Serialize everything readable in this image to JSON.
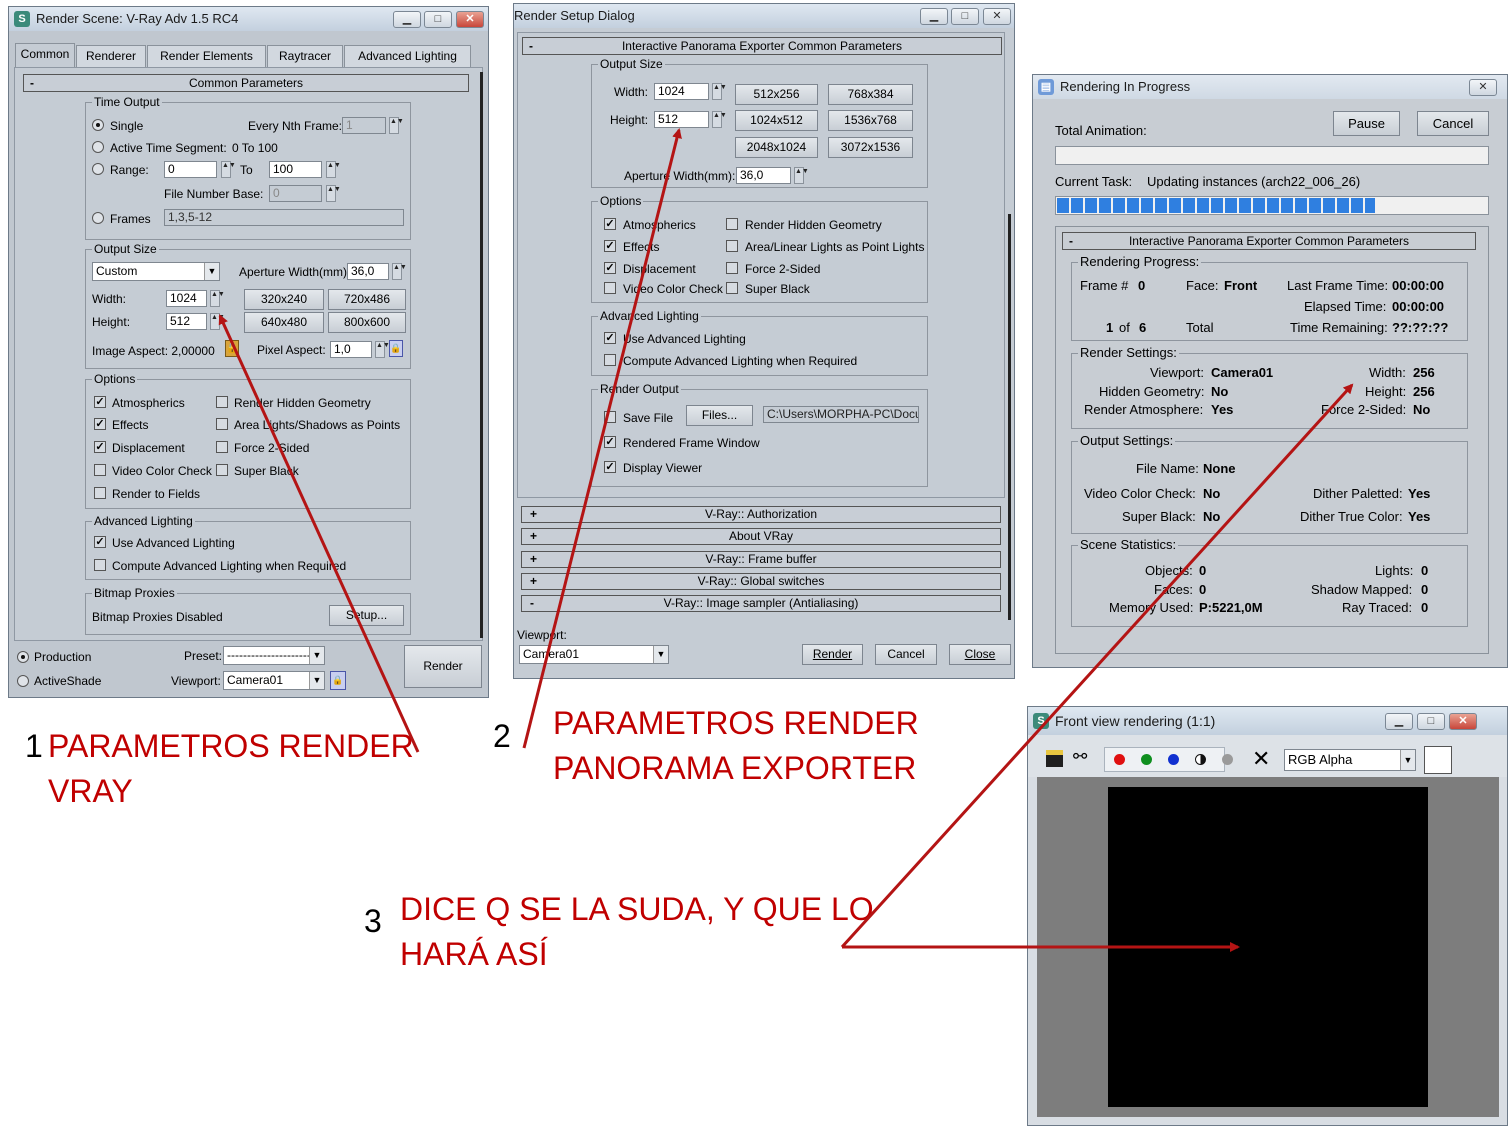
{
  "win1": {
    "title": "Render Scene: V-Ray Adv 1.5 RC4",
    "tabs": [
      "Common",
      "Renderer",
      "Render Elements",
      "Raytracer",
      "Advanced Lighting"
    ],
    "section": "Common Parameters",
    "time_output": {
      "label": "Time Output",
      "single": "Single",
      "every_nth": "Every Nth Frame:",
      "every_nth_value": "1",
      "active_segment": "Active Time Segment:",
      "active_segment_value": "0 To 100",
      "range": "Range:",
      "range_from": "0",
      "to": "To",
      "range_to": "100",
      "file_number_base": "File Number Base:",
      "file_number_base_value": "0",
      "frames": "Frames",
      "frames_value": "1,3,5-12"
    },
    "output_size": {
      "label": "Output Size",
      "preset": "Custom",
      "aperture": "Aperture Width(mm):",
      "aperture_value": "36,0",
      "width_label": "Width:",
      "width_value": "1024",
      "height_label": "Height:",
      "height_value": "512",
      "presets": [
        "320x240",
        "720x486",
        "640x480",
        "800x600"
      ],
      "image_aspect": "Image Aspect: 2,00000",
      "pixel_aspect": "Pixel Aspect:",
      "pixel_aspect_value": "1,0"
    },
    "options": {
      "label": "Options",
      "left": [
        "Atmospherics",
        "Effects",
        "Displacement",
        "Video Color Check",
        "Render to Fields"
      ],
      "right": [
        "Render Hidden Geometry",
        "Area Lights/Shadows as Points",
        "Force 2-Sided",
        "Super Black"
      ]
    },
    "advanced_lighting": {
      "label": "Advanced Lighting",
      "use": "Use Advanced Lighting",
      "compute": "Compute Advanced Lighting when Required"
    },
    "bitmap_proxies": {
      "label": "Bitmap Proxies",
      "status": "Bitmap Proxies Disabled",
      "setup": "Setup..."
    },
    "footer": {
      "production": "Production",
      "activeshade": "ActiveShade",
      "preset_label": "Preset:",
      "preset_value": "----------------------",
      "viewport_label": "Viewport:",
      "viewport_value": "Camera01",
      "render": "Render"
    }
  },
  "win2": {
    "title": "Render Setup Dialog",
    "section": "Interactive Panorama Exporter Common Parameters",
    "output_size": {
      "label": "Output Size",
      "width_label": "Width:",
      "width_value": "1024",
      "height_label": "Height:",
      "height_value": "512",
      "presets": [
        "512x256",
        "768x384",
        "1024x512",
        "1536x768",
        "2048x1024",
        "3072x1536"
      ],
      "aperture": "Aperture Width(mm):",
      "aperture_value": "36,0"
    },
    "options": {
      "label": "Options",
      "left": [
        "Atmospherics",
        "Effects",
        "Displacement",
        "Video Color Check"
      ],
      "right": [
        "Render Hidden Geometry",
        "Area/Linear Lights as Point Lights",
        "Force 2-Sided",
        "Super Black"
      ]
    },
    "advanced_lighting": {
      "label": "Advanced Lighting",
      "use": "Use Advanced Lighting",
      "compute": "Compute Advanced Lighting when Required"
    },
    "render_output": {
      "label": "Render Output",
      "save_file": "Save File",
      "files": "Files...",
      "path": "C:\\Users\\MORPHA-PC\\Docu",
      "rendered_frame_window": "Rendered Frame Window",
      "display_viewer": "Display Viewer"
    },
    "rollouts": [
      {
        "sign": "+",
        "label": "V-Ray:: Authorization"
      },
      {
        "sign": "+",
        "label": "About VRay"
      },
      {
        "sign": "+",
        "label": "V-Ray:: Frame buffer"
      },
      {
        "sign": "+",
        "label": "V-Ray:: Global switches"
      },
      {
        "sign": "-",
        "label": "V-Ray:: Image sampler (Antialiasing)"
      }
    ],
    "footer": {
      "viewport_label": "Viewport:",
      "viewport_value": "Camera01",
      "render": "Render",
      "cancel": "Cancel",
      "close": "Close"
    }
  },
  "win3": {
    "title": "Rendering In Progress",
    "total_animation": "Total Animation:",
    "pause": "Pause",
    "cancel": "Cancel",
    "current_task_label": "Current Task:",
    "current_task_value": "Updating instances (arch22_006_26)",
    "task_progress": 0.74,
    "progress_color": "#2f7fe0",
    "section": "Interactive Panorama Exporter Common Parameters",
    "rendering_progress": {
      "label": "Rendering Progress:",
      "frame_label": "Frame #",
      "frame_value": "0",
      "face_label": "Face:",
      "face_value": "Front",
      "last_frame_label": "Last Frame Time:",
      "last_frame_value": "00:00:00",
      "elapsed_label": "Elapsed Time:",
      "elapsed_value": "00:00:00",
      "count_a": "1",
      "of": "of",
      "count_b": "6",
      "total": "Total",
      "remaining_label": "Time Remaining:",
      "remaining_value": "??:??:??"
    },
    "render_settings": {
      "label": "Render Settings:",
      "viewport_label": "Viewport:",
      "viewport_value": "Camera01",
      "width_label": "Width:",
      "width_value": "256",
      "hidden_label": "Hidden Geometry:",
      "hidden_value": "No",
      "height_label": "Height:",
      "height_value": "256",
      "atmos_label": "Render Atmosphere:",
      "atmos_value": "Yes",
      "force_label": "Force 2-Sided:",
      "force_value": "No"
    },
    "output_settings": {
      "label": "Output Settings:",
      "file_label": "File Name:",
      "file_value": "None",
      "vcc_label": "Video Color Check:",
      "vcc_value": "No",
      "dither_pal_label": "Dither Paletted:",
      "dither_pal_value": "Yes",
      "sb_label": "Super Black:",
      "sb_value": "No",
      "dither_true_label": "Dither True Color:",
      "dither_true_value": "Yes"
    },
    "scene_statistics": {
      "label": "Scene Statistics:",
      "objects_label": "Objects:",
      "objects_value": "0",
      "lights_label": "Lights:",
      "lights_value": "0",
      "faces_label": "Faces:",
      "faces_value": "0",
      "shadow_label": "Shadow Mapped:",
      "shadow_value": "0",
      "memory_label": "Memory Used:",
      "memory_value": "P:5221,0M",
      "ray_label": "Ray Traced:",
      "ray_value": "0"
    }
  },
  "win4": {
    "title": "Front view rendering (1:1)",
    "channel": "RGB Alpha",
    "toolbar_icons": [
      "save-icon",
      "clone-icon",
      "red-channel-icon",
      "green-channel-icon",
      "blue-channel-icon",
      "mono-icon",
      "alpha-icon",
      "clear-icon"
    ]
  },
  "annotations": [
    {
      "number": "1",
      "line1": "PARAMETROS RENDER",
      "line2": "VRAY"
    },
    {
      "number": "2",
      "line1": "PARAMETROS RENDER",
      "line2": "PANORAMA EXPORTER"
    },
    {
      "number": "3",
      "line1": "DICE Q SE LA SUDA, Y QUE LO",
      "line2": "HARÁ ASÍ"
    }
  ],
  "colors": {
    "annotation": "#c00000",
    "arrow": "#b41414"
  }
}
